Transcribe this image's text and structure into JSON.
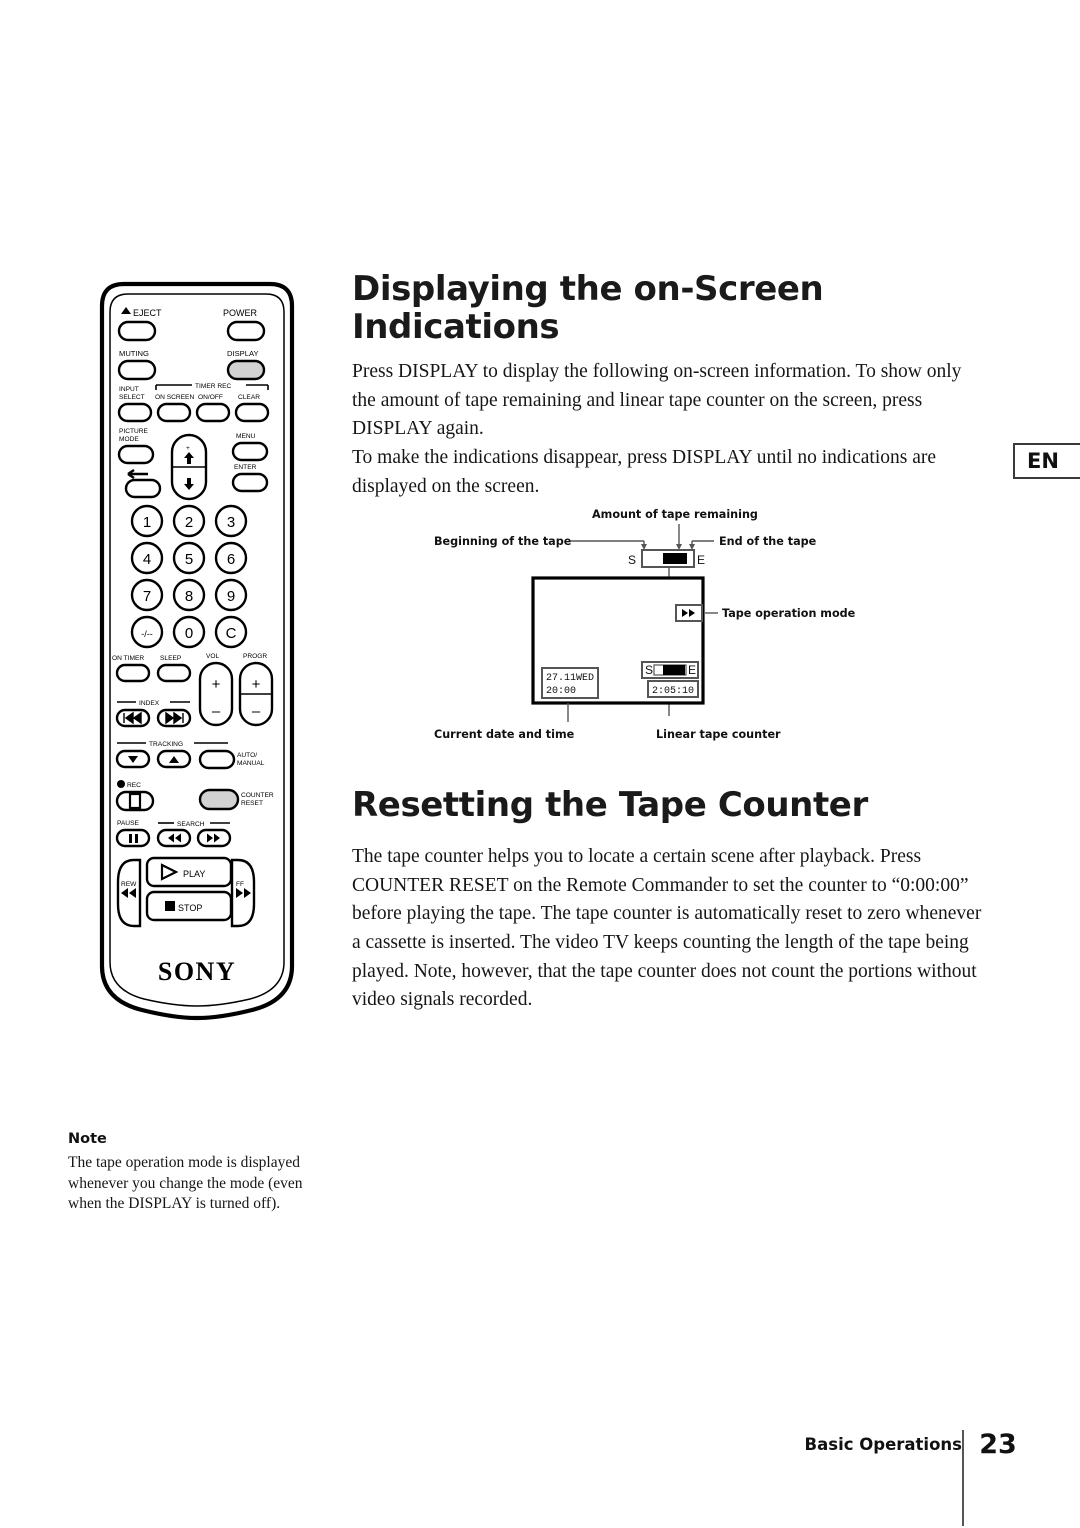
{
  "page": {
    "language_tab": "EN",
    "footer_chapter": "Basic Operations",
    "footer_page_number": "23"
  },
  "sections": [
    {
      "title": "Displaying the on-Screen Indications",
      "paragraphs": [
        "Press DISPLAY to display the following on-screen information. To show only the amount of tape remaining and linear tape counter on the screen, press DISPLAY again.",
        "To make the indications disappear, press DISPLAY until no indications are displayed on the screen."
      ]
    },
    {
      "title": "Resetting the Tape Counter",
      "paragraphs": [
        "The tape counter helps you to locate a certain scene after playback.  Press COUNTER RESET on the Remote Commander to set the counter to “0:00:00” before playing the tape. The tape counter is automatically reset to zero whenever a cassette is inserted.  The video TV keeps counting the length of the tape being played.  Note, however, that the tape counter does not count the portions without video signals recorded."
      ]
    }
  ],
  "note": {
    "heading": "Note",
    "text": "The tape operation mode is displayed whenever you change the mode (even when the DISPLAY is turned off)."
  },
  "osd_diagram": {
    "callouts": {
      "amount_remaining": "Amount of tape remaining",
      "beginning": "Beginning of the tape",
      "end": "End of the tape",
      "tape_operation_mode": "Tape operation mode",
      "current_date_time": "Current date and time",
      "linear_tape_counter": "Linear tape counter"
    },
    "screen": {
      "top_bar_start_label": "S",
      "top_bar_end_label": "E",
      "inner_bar_start_label": "S",
      "inner_bar_end_label": "E",
      "date_line": "27.11WED",
      "time_line": "20:00",
      "counter_value": "2:05:10",
      "mode_icon": "fast-forward-icon"
    }
  },
  "remote": {
    "brand": "SONY",
    "highlight_color": "#d2d2d2",
    "buttons": {
      "eject": "EJECT",
      "power": "POWER",
      "muting": "MUTING",
      "display": "DISPLAY",
      "input_select_line1": "INPUT",
      "input_select_line2": "SELECT",
      "on_screen": "ON SCREEN",
      "timer_rec": "TIMER REC",
      "on_off": "ON/OFF",
      "clear": "CLEAR",
      "picture_mode_line1": "PICTURE",
      "picture_mode_line2": "MODE",
      "menu": "MENU",
      "enter": "ENTER",
      "num_1": "1",
      "num_2": "2",
      "num_3": "3",
      "num_4": "4",
      "num_5": "5",
      "num_6": "6",
      "num_7": "7",
      "num_8": "8",
      "num_9": "9",
      "num_dash": "-/--",
      "num_0": "0",
      "num_c": "C",
      "on_timer": "ON TIMER",
      "sleep": "SLEEP",
      "vol": "VOL",
      "progr": "PROGR",
      "plus": "+",
      "minus": "–",
      "index": "INDEX",
      "tracking": "TRACKING",
      "auto_manual_line1": "AUTO/",
      "auto_manual_line2": "MANUAL",
      "rec": "REC",
      "counter_reset_line1": "COUNTER",
      "counter_reset_line2": "RESET",
      "pause": "PAUSE",
      "search": "SEARCH",
      "play": "PLAY",
      "stop": "STOP",
      "rew": "REW",
      "ff": "FF"
    }
  }
}
